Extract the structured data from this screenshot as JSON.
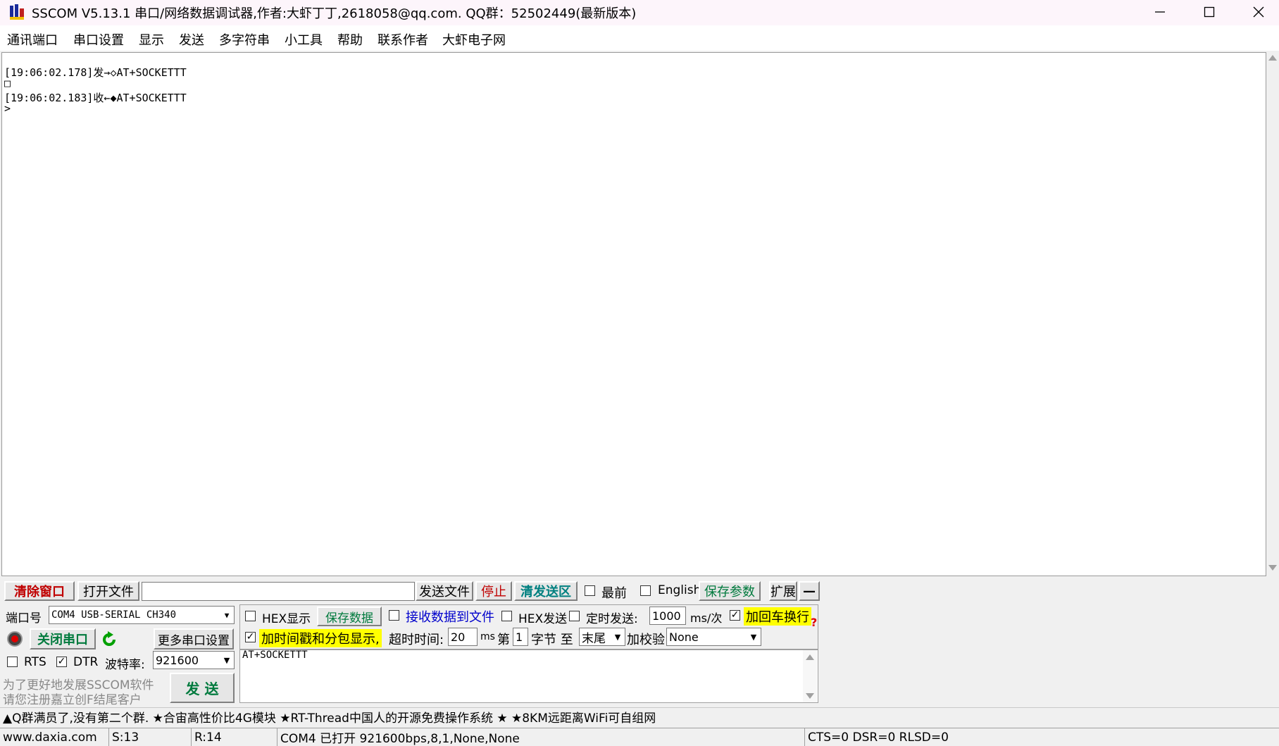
{
  "window": {
    "title": "SSCOM V5.13.1 串口/网络数据调试器,作者:大虾丁丁,2618058@qq.com. QQ群：52502449(最新版本)",
    "minimize_icon": "minimize-icon",
    "maximize_icon": "maximize-icon",
    "close_icon": "close-icon"
  },
  "menu": [
    "通讯端口",
    "串口设置",
    "显示",
    "发送",
    "多字符串",
    "小工具",
    "帮助",
    "联系作者",
    "大虾电子网"
  ],
  "receive": {
    "lines": [
      "[19:06:02.178]发→◇AT+SOCKETTT",
      "□",
      "[19:06:02.183]收←◆AT+SOCKETTT",
      ">"
    ]
  },
  "toolbar": {
    "clear_window": "清除窗口",
    "open_file": "打开文件",
    "file_path": "",
    "send_file": "发送文件",
    "stop": "停止",
    "clear_send": "清发送区",
    "topmost": "最前",
    "english": "English",
    "save_params": "保存参数",
    "expand": "扩展",
    "collapse": "—"
  },
  "port": {
    "port_label": "端口号",
    "port_value": "COM4 USB-SERIAL CH340",
    "close_port": "关闭串口",
    "more_settings": "更多串口设置",
    "rts": "RTS",
    "dtr": "DTR",
    "baud_label": "波特率:",
    "baud_value": "921600",
    "promo_line1": "为了更好地发展SSCOM软件",
    "promo_line2": "请您注册嘉立创F结尾客户",
    "send_button": "发  送"
  },
  "options": {
    "hex_display": "HEX显示",
    "save_data": "保存数据",
    "recv_to_file": "接收数据到文件",
    "hex_send": "HEX发送",
    "timed_send": "定时发送:",
    "interval_value": "1000",
    "interval_unit": "ms/次",
    "add_crlf": "加回车换行",
    "timestamp": "加时间戳和分包显示,",
    "timeout_label": "超时时间:",
    "timeout_value": "20",
    "timeout_unit": "ms",
    "byte_from_label": "第",
    "byte_from_value": "1",
    "byte_label": "字节 至",
    "byte_to_value": "末尾",
    "checksum_label": "加校验",
    "checksum_value": "None",
    "help_mark": "?"
  },
  "send_text": "AT+SOCKETTT",
  "ticker": "▲Q群满员了,没有第二个群. ★合宙高性价比4G模块 ★RT-Thread中国人的开源免费操作系统 ★ ★8KM远距离WiFi可自组网",
  "status": {
    "website": "www.daxia.com",
    "sent": "S:13",
    "received": "R:14",
    "port_state": "COM4 已打开  921600bps,8,1,None,None",
    "lines": "CTS=0 DSR=0 RLSD=0"
  },
  "colors": {
    "accent_red": "#c00000",
    "accent_green": "#007a3d",
    "accent_blue": "#0000cc",
    "highlight_yellow": "#ffff00",
    "teal": "#008080"
  }
}
